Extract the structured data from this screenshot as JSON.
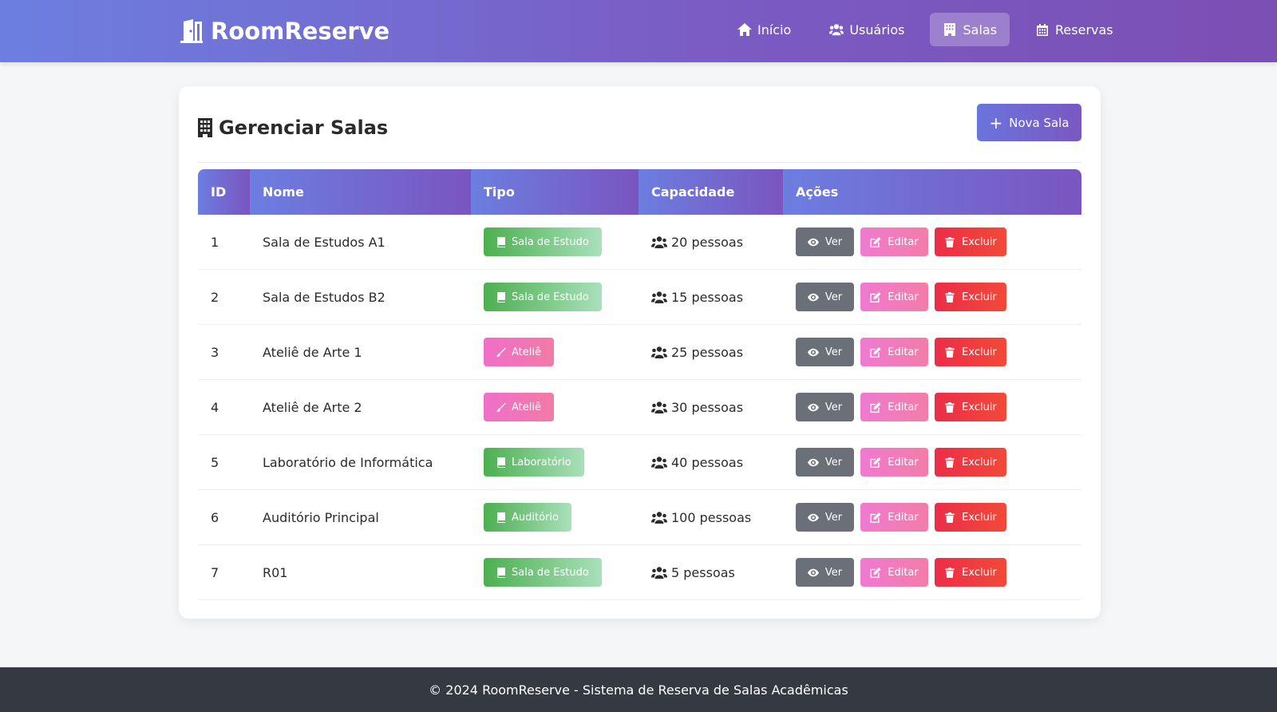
{
  "brand": {
    "name": "RoomReserve",
    "icon": "door-open-icon"
  },
  "nav": [
    {
      "label": "Início",
      "icon": "home-icon",
      "active": false
    },
    {
      "label": "Usuários",
      "icon": "users-icon",
      "active": false
    },
    {
      "label": "Salas",
      "icon": "building-icon",
      "active": true
    },
    {
      "label": "Reservas",
      "icon": "calendar-icon",
      "active": false
    }
  ],
  "page": {
    "title": "Gerenciar Salas",
    "title_icon": "building-icon",
    "new_button": "Nova Sala"
  },
  "table": {
    "headers": [
      "ID",
      "Nome",
      "Tipo",
      "Capacidade",
      "Ações"
    ],
    "rows": [
      {
        "id": "1",
        "nome": "Sala de Estudos A1",
        "tipo": "Sala de Estudo",
        "tipo_color": "green",
        "tipo_icon": "book-icon",
        "capacidade": "20 pessoas"
      },
      {
        "id": "2",
        "nome": "Sala de Estudos B2",
        "tipo": "Sala de Estudo",
        "tipo_color": "green",
        "tipo_icon": "book-icon",
        "capacidade": "15 pessoas"
      },
      {
        "id": "3",
        "nome": "Ateliê de Arte 1",
        "tipo": "Ateliê",
        "tipo_color": "pink",
        "tipo_icon": "paintbrush-icon",
        "capacidade": "25 pessoas"
      },
      {
        "id": "4",
        "nome": "Ateliê de Arte 2",
        "tipo": "Ateliê",
        "tipo_color": "pink",
        "tipo_icon": "paintbrush-icon",
        "capacidade": "30 pessoas"
      },
      {
        "id": "5",
        "nome": "Laboratório de Informática",
        "tipo": "Laboratório",
        "tipo_color": "green",
        "tipo_icon": "book-icon",
        "capacidade": "40 pessoas"
      },
      {
        "id": "6",
        "nome": "Auditório Principal",
        "tipo": "Auditório",
        "tipo_color": "green",
        "tipo_icon": "book-icon",
        "capacidade": "100 pessoas"
      },
      {
        "id": "7",
        "nome": "R01",
        "tipo": "Sala de Estudo",
        "tipo_color": "green",
        "tipo_icon": "book-icon",
        "capacidade": "5 pessoas"
      }
    ],
    "actions": {
      "view": "Ver",
      "edit": "Editar",
      "delete": "Excluir"
    }
  },
  "footer": {
    "text": "© 2024 RoomReserve - Sistema de Reserva de Salas Acadêmicas"
  },
  "colors": {
    "nav_gradient_start": "#6c7fe0",
    "nav_gradient_end": "#7b4fb4",
    "badge_green": "#4caf50",
    "badge_pink": "#f06fc9",
    "btn_view": "#6b7078",
    "btn_edit": "#f07ad0",
    "btn_delete": "#ec2d48",
    "footer_bg": "#353a42"
  }
}
